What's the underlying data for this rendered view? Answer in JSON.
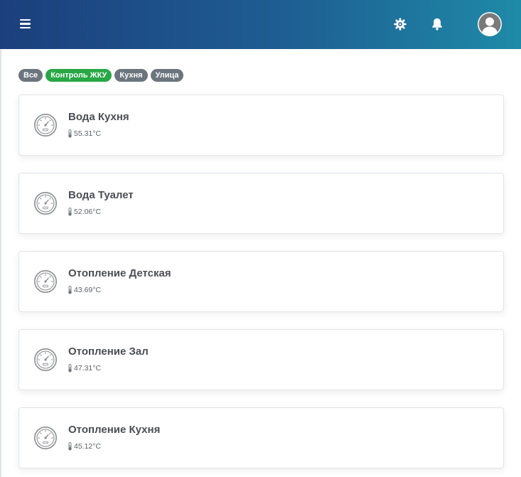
{
  "header": {
    "menu_icon": "hamburger-menu-icon",
    "settings_icon": "gear-icon",
    "notifications_icon": "bell-icon",
    "avatar_icon": "user-avatar-icon"
  },
  "filters": [
    {
      "label": "Все",
      "active": false
    },
    {
      "label": "Контроль ЖКУ",
      "active": true
    },
    {
      "label": "Кухня",
      "active": false
    },
    {
      "label": "Улица",
      "active": false
    }
  ],
  "colors": {
    "chip_default": "#6c757d",
    "chip_active": "#28a745",
    "header_gradient_start": "#1c3f7c",
    "header_gradient_end": "#1f8aa8"
  },
  "sensors": [
    {
      "name": "Вода Кухня",
      "temperature": "55.31°C",
      "icon": "gauge-icon"
    },
    {
      "name": "Вода Туалет",
      "temperature": "52.06°C",
      "icon": "gauge-icon"
    },
    {
      "name": "Отопление Детская",
      "temperature": "43.69°C",
      "icon": "gauge-icon"
    },
    {
      "name": "Отопление Зал",
      "temperature": "47.31°C",
      "icon": "gauge-icon"
    },
    {
      "name": "Отопление Кухня",
      "temperature": "45.12°C",
      "icon": "gauge-icon"
    }
  ]
}
